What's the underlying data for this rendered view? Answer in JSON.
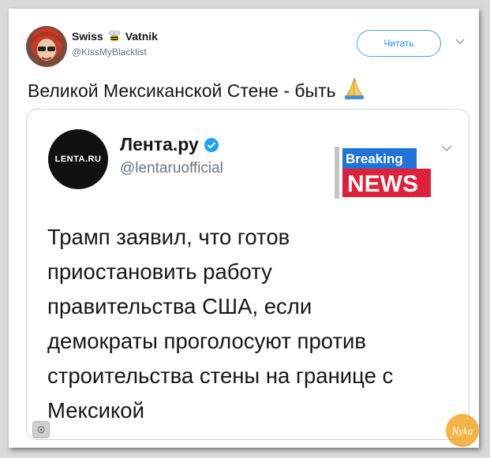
{
  "tweet": {
    "display_name_part1": "Swiss",
    "display_name_part2": "Vatnik",
    "handle": "@KissMyBlacklist",
    "follow_label": "Читать",
    "text": "Великой Мексиканской Стене - быть",
    "emoji_icon": "praying-hands-icon"
  },
  "quoted": {
    "logo_text": "LENTA.RU",
    "display_name": "Лента.ру",
    "handle": "@lentaruofficial",
    "badge_top": "Breaking",
    "badge_bottom": "NEWS",
    "text_lines": [
      "Трамп заявил, что готов",
      "приостановить работу",
      "правительства США, если",
      "демократы проголосуют против",
      "строительства стены на границе с",
      "Мексикой"
    ]
  },
  "watermark_text": "Nyka",
  "colors": {
    "accent": "#1b95e0",
    "badge_red": "#e0203a",
    "badge_blue": "#1f73d6"
  }
}
